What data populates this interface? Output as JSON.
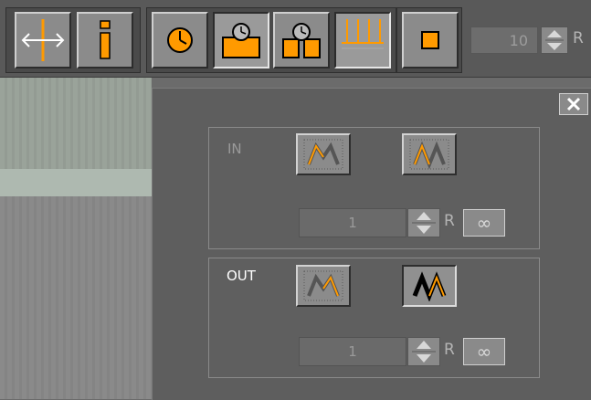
{
  "toolbar": {
    "buttons": [
      {
        "name": "width-toggle-button",
        "icon": "resize-horizontal-icon",
        "active": false
      },
      {
        "name": "info-button",
        "icon": "info-icon",
        "active": false
      },
      {
        "name": "clock-button",
        "icon": "clock-icon",
        "active": false
      },
      {
        "name": "single-clock-button",
        "icon": "clock-block-icon",
        "active": true
      },
      {
        "name": "split-clock-button",
        "icon": "clock-split-icon",
        "active": false
      },
      {
        "name": "timeline-button",
        "icon": "timeline-icon",
        "active": true
      },
      {
        "name": "stop-button",
        "icon": "square-icon",
        "active": false
      }
    ],
    "number_value": "10",
    "r_label": "R"
  },
  "dialog": {
    "close_label": "✕",
    "in": {
      "label": "IN",
      "value": "1",
      "r_label": "R",
      "infinity_label": "∞"
    },
    "out": {
      "label": "OUT",
      "value": "1",
      "r_label": "R",
      "infinity_label": "∞"
    }
  },
  "colors": {
    "accent": "#ff9a00",
    "background": "#6b6b6b",
    "panel": "#5e5e5e"
  }
}
